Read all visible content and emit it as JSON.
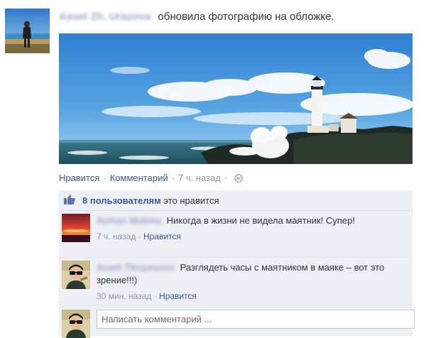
{
  "post": {
    "author_name": "Assel Zh. Urazova",
    "action_text": "обновила фотографию на обложке.",
    "actions": {
      "like_label": "Нравится",
      "comment_label": "Комментарий",
      "time": "7 ч. назад",
      "privacy_icon": "globe-icon"
    }
  },
  "feedback": {
    "likes_count_text": "8 пользователям",
    "likes_suffix": "это нравится",
    "like_icon": "thumbs-up-icon",
    "comments": [
      {
        "author": "Aizhan Mukina",
        "text": "Никогда в жизни не видела маятник! Супер!",
        "time": "7 ч. назад",
        "like_label": "Нравится"
      },
      {
        "author": "Asset Tleuyessov",
        "text": "Разглядеть часы с маятником в маяке – вот это зрение!!!)",
        "time": "30 мин. назад",
        "like_label": "Нравится"
      }
    ],
    "composer_placeholder": "Написать комментарий ..."
  },
  "colors": {
    "link": "#3b5998",
    "feedback_bg": "#edeff4",
    "meta": "#9197a3"
  }
}
